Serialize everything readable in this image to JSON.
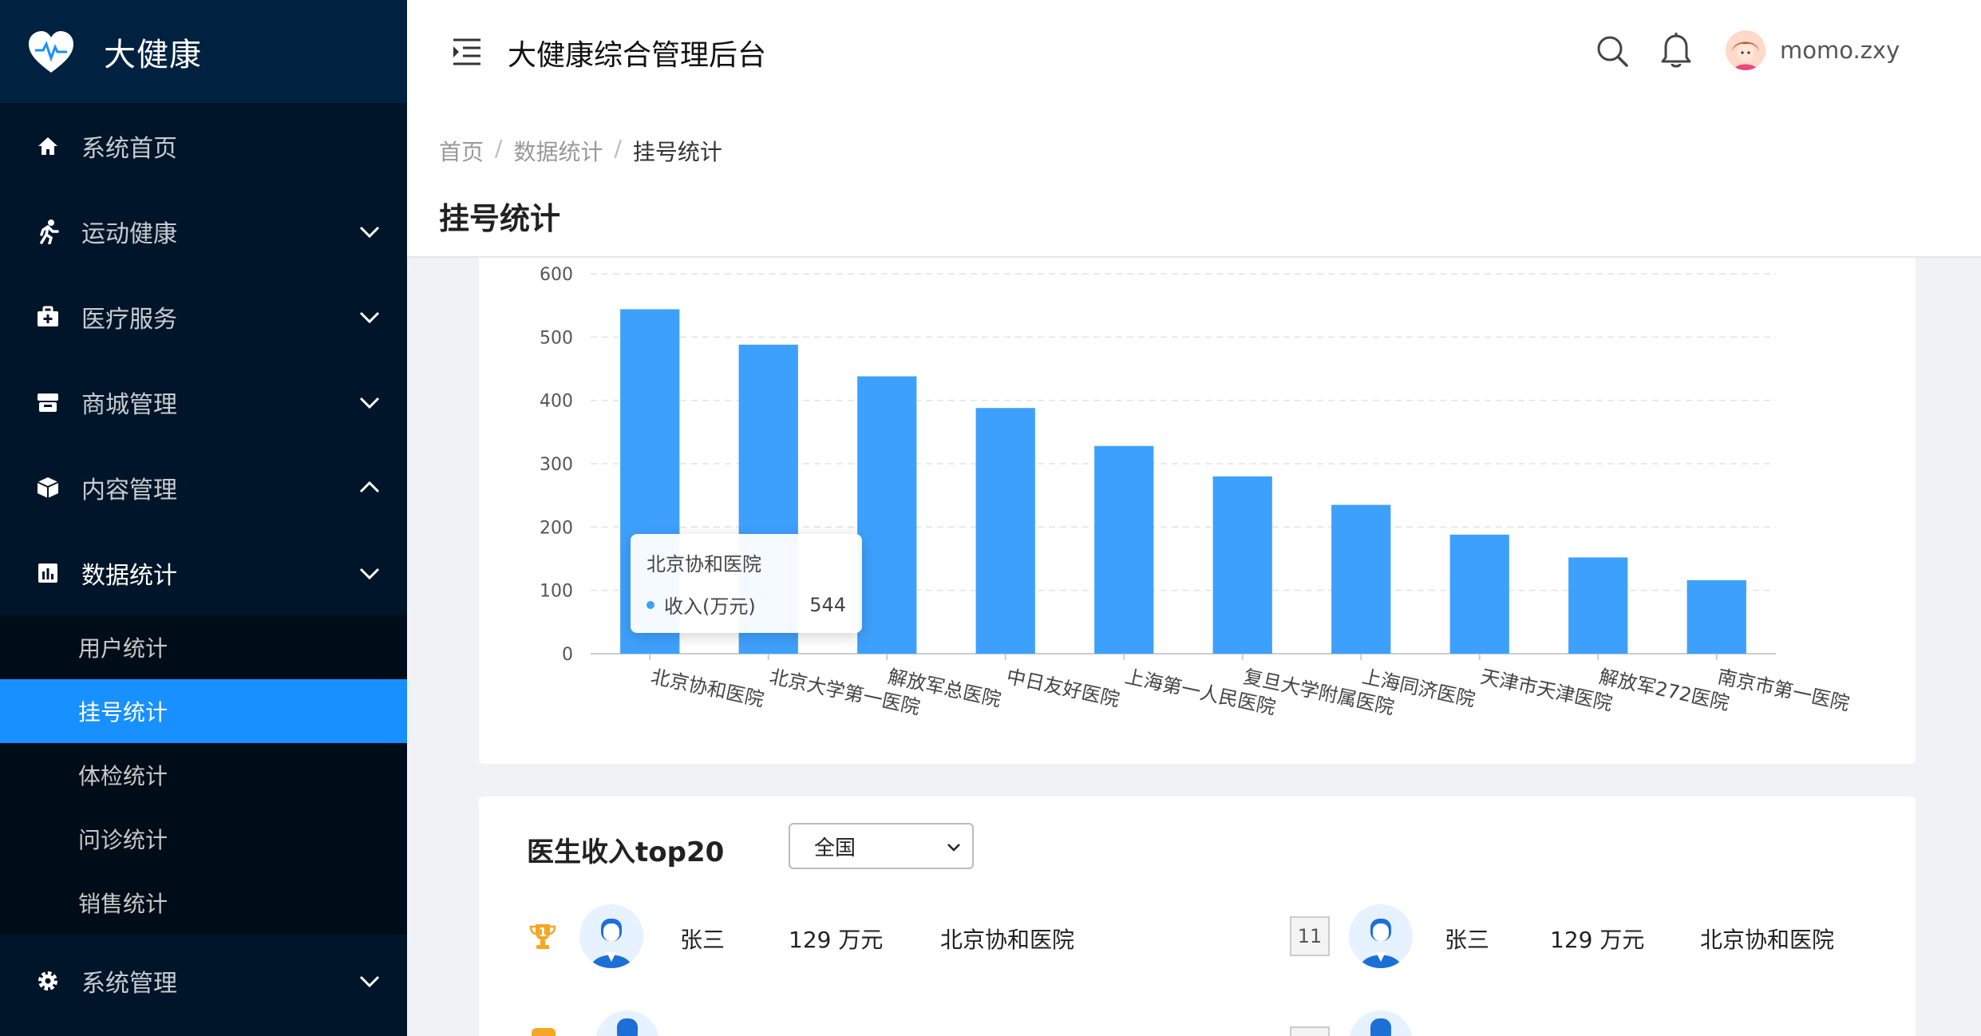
{
  "app": {
    "logo_text": "大健康",
    "title": "大健康综合管理后台",
    "username": "momo.zxy"
  },
  "sidebar": {
    "items": [
      {
        "label": "系统首页",
        "icon": "home-icon"
      },
      {
        "label": "运动健康",
        "icon": "running-icon"
      },
      {
        "label": "医疗服务",
        "icon": "medical-kit-icon"
      },
      {
        "label": "商城管理",
        "icon": "store-icon"
      },
      {
        "label": "内容管理",
        "icon": "box-icon"
      },
      {
        "label": "数据统计",
        "icon": "bar-chart-icon"
      },
      {
        "label": "系统管理",
        "icon": "gear-icon"
      }
    ],
    "data_sub": [
      "用户统计",
      "挂号统计",
      "体检统计",
      "问诊统计",
      "销售统计"
    ]
  },
  "breadcrumb": {
    "home": "首页",
    "section": "数据统计",
    "current": "挂号统计"
  },
  "page_title": "挂号统计",
  "chart_data": {
    "type": "bar",
    "categories": [
      "北京协和医院",
      "北京大学第一医院",
      "解放军总医院",
      "中日友好医院",
      "上海第一人民医院",
      "复旦大学附属医院",
      "上海同济医院",
      "天津市天津医院",
      "解放军272医院",
      "南京市第一医院"
    ],
    "series": [
      {
        "name": "收入(万元)",
        "values": [
          544,
          488,
          438,
          388,
          328,
          280,
          235,
          188,
          152,
          116
        ]
      }
    ],
    "ylim": [
      0,
      600
    ],
    "yticks": [
      0,
      100,
      200,
      300,
      400,
      500,
      600
    ],
    "grid": true,
    "color": "#3ea0fd",
    "tooltip": {
      "title": "北京协和医院",
      "series": "收入(万元)",
      "value": "544"
    }
  },
  "top20": {
    "title": "医生收入top20",
    "region": "全国",
    "rows": [
      {
        "rank": "1",
        "name": "张三",
        "money": "129 万元",
        "hospital": "北京协和医院"
      },
      {
        "rank": "11",
        "name": "张三",
        "money": "129 万元",
        "hospital": "北京协和医院"
      }
    ]
  },
  "colors": {
    "sidebar_bg": "#001529",
    "accent": "#1890ff",
    "bar": "#3ea0fd",
    "trophy": "#f5a623"
  }
}
